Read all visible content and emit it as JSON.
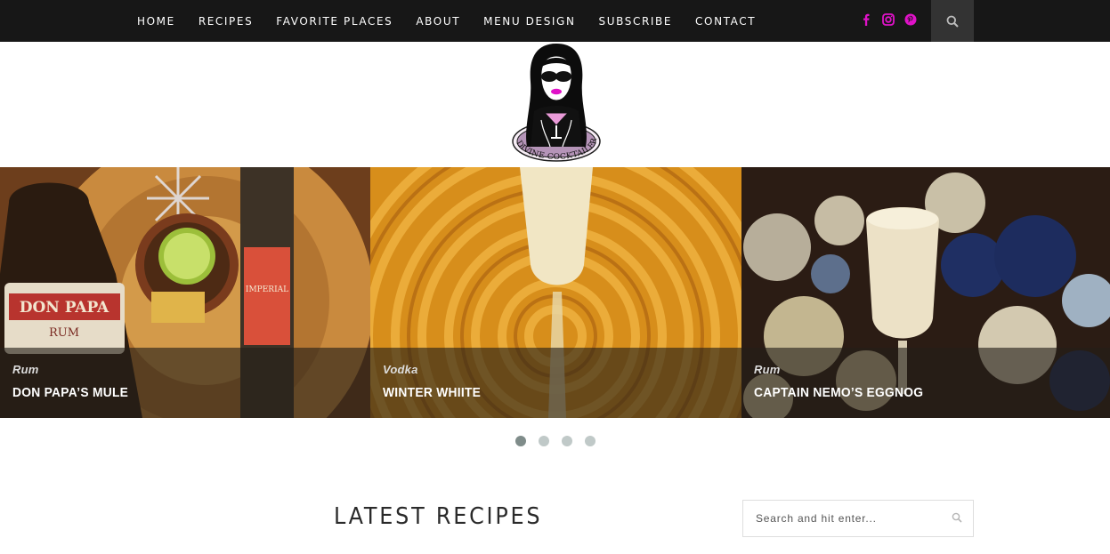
{
  "nav": {
    "items": [
      "HOME",
      "RECIPES",
      "FAVORITE PLACES",
      "ABOUT",
      "MENU DESIGN",
      "SUBSCRIBE",
      "CONTACT"
    ],
    "social_icons": [
      "facebook-icon",
      "instagram-icon",
      "pinterest-icon"
    ],
    "social_color": "#e012c8",
    "search_icon": "search-icon"
  },
  "logo": {
    "text": "DIVINE COCKTAILER"
  },
  "slides": [
    {
      "category": "Rum",
      "title": "DON PAPA’S MULE"
    },
    {
      "category": "Vodka",
      "title": "WINTER WHIITE"
    },
    {
      "category": "Rum",
      "title": "CAPTAIN NEMO’S EGGNOG"
    }
  ],
  "slider_dots": {
    "count": 4,
    "active": 1
  },
  "section": {
    "title": "LATEST RECIPES"
  },
  "sidebar": {
    "search_placeholder": "Search and hit enter..."
  },
  "colors": {
    "nav_bg": "#171717",
    "accent": "#e012c8",
    "dot": "#c0c9c8",
    "dot_active": "#7f8c8a"
  }
}
